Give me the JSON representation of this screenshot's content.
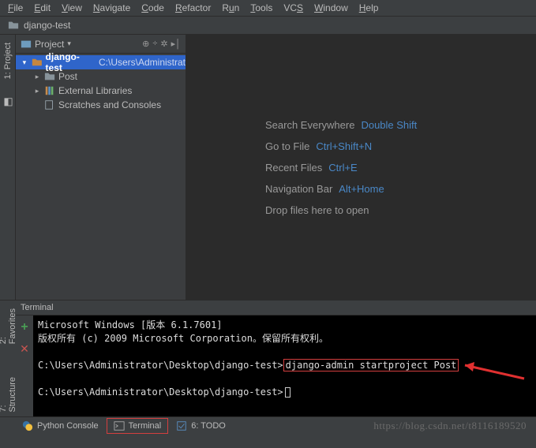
{
  "menu": {
    "file": "File",
    "edit": "Edit",
    "view": "View",
    "navigate": "Navigate",
    "code": "Code",
    "refactor": "Refactor",
    "run": "Run",
    "tools": "Tools",
    "vcs": "VCS",
    "window": "Window",
    "help": "Help"
  },
  "breadcrumb": {
    "project": "django-test"
  },
  "side": {
    "project": "1: Project",
    "structure": "7: Structure",
    "favorites": "2: Favorites"
  },
  "panel": {
    "title": "Project"
  },
  "tree": {
    "root_name": "django-test",
    "root_path": "C:\\Users\\Administrat",
    "post": "Post",
    "ext": "External Libraries",
    "scratch": "Scratches and Consoles"
  },
  "hints": {
    "search_label": "Search Everywhere",
    "search_key": "Double Shift",
    "goto_label": "Go to File",
    "goto_key": "Ctrl+Shift+N",
    "recent_label": "Recent Files",
    "recent_key": "Ctrl+E",
    "nav_label": "Navigation Bar",
    "nav_key": "Alt+Home",
    "drop_label": "Drop files here to open"
  },
  "terminal": {
    "title": "Terminal",
    "line1": "Microsoft Windows [版本 6.1.7601]",
    "line2": "版权所有 (c) 2009 Microsoft Corporation。保留所有权利。",
    "prompt1": "C:\\Users\\Administrator\\Desktop\\django-test>",
    "cmd": "django-admin startproject Post",
    "prompt2": "C:\\Users\\Administrator\\Desktop\\django-test>"
  },
  "bottom": {
    "python": "Python Console",
    "terminal": "Terminal",
    "todo": "6: TODO"
  },
  "watermark": "https://blog.csdn.net/t8116189520"
}
